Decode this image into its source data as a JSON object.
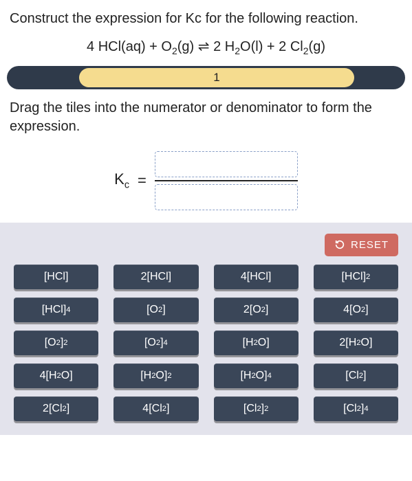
{
  "question": "Construct the expression for Kc for the following reaction.",
  "reaction": {
    "lhs1_coef": "4 ",
    "lhs1_species": "HCl(aq)",
    "plus1": " + ",
    "lhs2_species": "O",
    "lhs2_sub": "2",
    "lhs2_state": "(g)",
    "arrow": " ⇌ ",
    "rhs1_coef": "2 ",
    "rhs1_species": "H",
    "rhs1_sub": "2",
    "rhs1_rest": "O(l)",
    "plus2": " + ",
    "rhs2_coef": "2 ",
    "rhs2_species": "Cl",
    "rhs2_sub": "2",
    "rhs2_state": "(g)"
  },
  "progress": {
    "value": "1"
  },
  "instruction": "Drag the tiles into the numerator or denominator to form the expression.",
  "kc": {
    "label_base": "K",
    "label_sub": "c",
    "equals": "="
  },
  "reset": {
    "label": "RESET"
  },
  "tiles": [
    {
      "pre": "",
      "sp": "[HCl]",
      "sub": "",
      "sup": ""
    },
    {
      "pre": "2",
      "sp": "[HCl]",
      "sub": "",
      "sup": ""
    },
    {
      "pre": "4",
      "sp": "[HCl]",
      "sub": "",
      "sup": ""
    },
    {
      "pre": "",
      "sp": "[HCl]",
      "sub": "",
      "sup": "2"
    },
    {
      "pre": "",
      "sp": "[HCl]",
      "sub": "",
      "sup": "4"
    },
    {
      "pre": "",
      "sp": "[O",
      "sub": "2",
      "sup": "",
      "close": "]"
    },
    {
      "pre": "2",
      "sp": "[O",
      "sub": "2",
      "sup": "",
      "close": "]"
    },
    {
      "pre": "4",
      "sp": "[O",
      "sub": "2",
      "sup": "",
      "close": "]"
    },
    {
      "pre": "",
      "sp": "[O",
      "sub": "2",
      "sup": "2",
      "close": "]"
    },
    {
      "pre": "",
      "sp": "[O",
      "sub": "2",
      "sup": "4",
      "close": "]"
    },
    {
      "pre": "",
      "sp": "[H",
      "sub": "2",
      "sup": "",
      "close": "O]"
    },
    {
      "pre": "2",
      "sp": "[H",
      "sub": "2",
      "sup": "",
      "close": "O]"
    },
    {
      "pre": "4",
      "sp": "[H",
      "sub": "2",
      "sup": "",
      "close": "O]"
    },
    {
      "pre": "",
      "sp": "[H",
      "sub": "2",
      "sup": "2",
      "close": "O]"
    },
    {
      "pre": "",
      "sp": "[H",
      "sub": "2",
      "sup": "4",
      "close": "O]"
    },
    {
      "pre": "",
      "sp": "[Cl",
      "sub": "2",
      "sup": "",
      "close": "]"
    },
    {
      "pre": "2",
      "sp": "[Cl",
      "sub": "2",
      "sup": "",
      "close": "]"
    },
    {
      "pre": "4",
      "sp": "[Cl",
      "sub": "2",
      "sup": "",
      "close": "]"
    },
    {
      "pre": "",
      "sp": "[Cl",
      "sub": "2",
      "sup": "2",
      "close": "]"
    },
    {
      "pre": "",
      "sp": "[Cl",
      "sub": "2",
      "sup": "4",
      "close": "]"
    }
  ]
}
